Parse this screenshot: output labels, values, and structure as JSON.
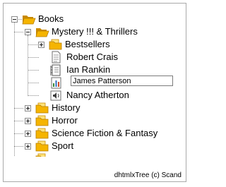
{
  "tree": {
    "root": {
      "label": "Books",
      "expanded": true,
      "icon": "folder-open-icon"
    },
    "mystery": {
      "label": "Mystery !!! & Thrillers",
      "expanded": true,
      "icon": "folder-open-icon"
    },
    "bestsellers": {
      "label": "Bestsellers",
      "expanded": false,
      "icon": "folder-icon"
    },
    "robert_crais": {
      "label": "Robert Crais",
      "icon": "document-icon"
    },
    "ian_rankin": {
      "label": "Ian Rankin",
      "icon": "book-icon"
    },
    "james_patterson": {
      "edit_value": "James Patterson",
      "icon": "chart-icon"
    },
    "nancy_atherton": {
      "label": "Nancy Atherton",
      "icon": "speaker-icon"
    },
    "history": {
      "label": "History",
      "expanded": false,
      "icon": "folder-icon"
    },
    "horror": {
      "label": "Horror",
      "expanded": false,
      "icon": "folder-icon"
    },
    "scifi": {
      "label": "Science Fiction & Fantasy",
      "expanded": false,
      "icon": "folder-icon"
    },
    "sport": {
      "label": "Sport",
      "expanded": false,
      "icon": "folder-icon"
    }
  },
  "footer": {
    "text": "dhtmlxTree (c) Scand"
  },
  "colors": {
    "folder": "#f5b400",
    "folder_dark": "#c98a00",
    "border": "#a9a9a9",
    "tree_lines": "#8a8a8a"
  }
}
